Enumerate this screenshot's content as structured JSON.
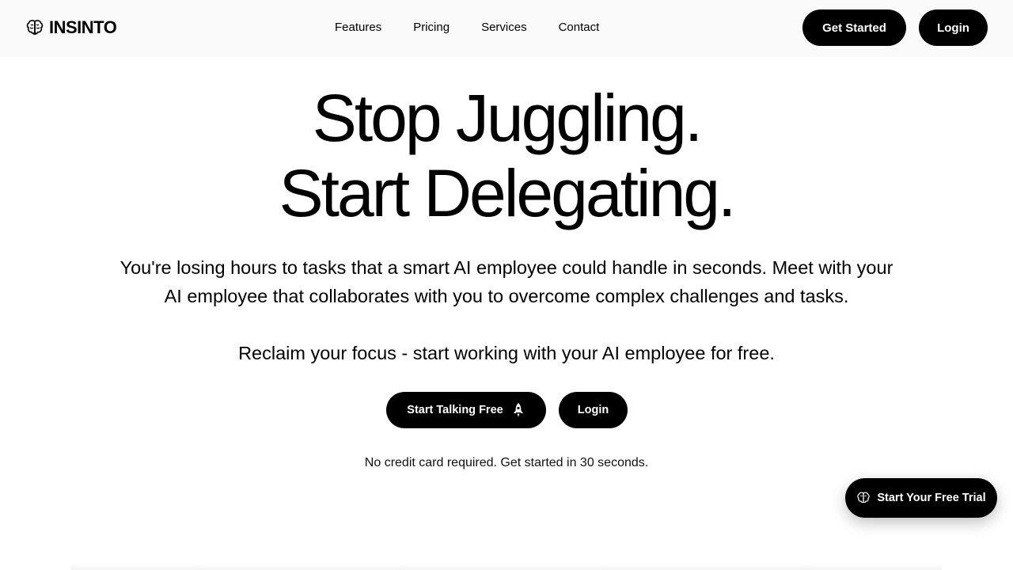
{
  "brand": {
    "name": "INSINTO",
    "icon": "brain-icon"
  },
  "nav": {
    "items": [
      {
        "label": "Features"
      },
      {
        "label": "Pricing"
      },
      {
        "label": "Services"
      },
      {
        "label": "Contact"
      }
    ]
  },
  "header_actions": {
    "get_started_label": "Get Started",
    "login_label": "Login"
  },
  "hero": {
    "title_line1": "Stop Juggling.",
    "title_line2": "Start Delegating.",
    "description": "You're losing hours to tasks that a smart AI employee could handle in seconds. Meet with your AI employee that collaborates with you to overcome complex challenges and tasks.",
    "cta_text": "Reclaim your focus - start working with your AI employee for free.",
    "primary_button_label": "Start Talking Free",
    "primary_button_icon": "rocket-icon",
    "secondary_button_label": "Login",
    "note": "No credit card required. Get started in 30 seconds."
  },
  "floating_cta": {
    "label": "Start Your Free Trial",
    "icon": "brain-icon"
  },
  "colors": {
    "primary": "#000000",
    "background": "#ffffff",
    "header_bg": "#fafafa"
  }
}
